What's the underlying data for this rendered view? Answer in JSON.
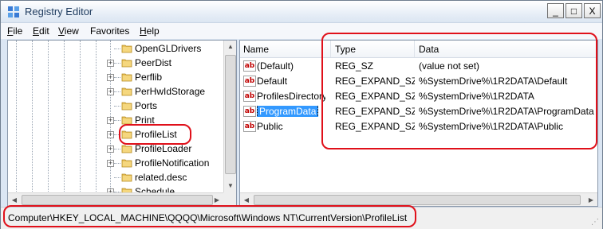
{
  "window": {
    "title": "Registry Editor",
    "minimize": "_",
    "maximize": "□",
    "close": "X"
  },
  "menu": [
    {
      "label": "File",
      "key": "F",
      "rest": "ile"
    },
    {
      "label": "Edit",
      "key": "E",
      "rest": "dit"
    },
    {
      "label": "View",
      "key": "V",
      "rest": "iew"
    },
    {
      "label": "Favorites",
      "key": "",
      "rest": "Favorites"
    },
    {
      "label": "Help",
      "key": "H",
      "rest": "elp"
    }
  ],
  "tree": {
    "items": [
      {
        "label": "OpenGLDrivers",
        "expandable": false
      },
      {
        "label": "PeerDist",
        "expandable": true
      },
      {
        "label": "Perflib",
        "expandable": true
      },
      {
        "label": "PerHwIdStorage",
        "expandable": true
      },
      {
        "label": "Ports",
        "expandable": false
      },
      {
        "label": "Print",
        "expandable": true
      },
      {
        "label": "ProfileList",
        "expandable": true,
        "selected": true
      },
      {
        "label": "ProfileLoader",
        "expandable": true
      },
      {
        "label": "ProfileNotification",
        "expandable": true
      },
      {
        "label": "related.desc",
        "expandable": false
      },
      {
        "label": "Schedule",
        "expandable": true
      }
    ]
  },
  "list": {
    "headers": {
      "name": "Name",
      "type": "Type",
      "data": "Data"
    },
    "rows": [
      {
        "name": "(Default)",
        "type": "REG_SZ",
        "data": "(value not set)"
      },
      {
        "name": "Default",
        "type": "REG_EXPAND_SZ",
        "data": "%SystemDrive%\\1R2DATA\\Default"
      },
      {
        "name": "ProfilesDirectory",
        "type": "REG_EXPAND_SZ",
        "data": "%SystemDrive%\\1R2DATA"
      },
      {
        "name": "ProgramData",
        "type": "REG_EXPAND_SZ",
        "data": "%SystemDrive%\\1R2DATA\\ProgramData",
        "selected": true
      },
      {
        "name": "Public",
        "type": "REG_EXPAND_SZ",
        "data": "%SystemDrive%\\1R2DATA\\Public"
      }
    ],
    "value_icon": "ab"
  },
  "statusbar": {
    "path": "Computer\\HKEY_LOCAL_MACHINE\\QQQQ\\Microsoft\\Windows NT\\CurrentVersion\\ProfileList"
  },
  "colors": {
    "annotation": "#e0101a",
    "selection": "#3399ff",
    "folder": "#e8c15a"
  }
}
